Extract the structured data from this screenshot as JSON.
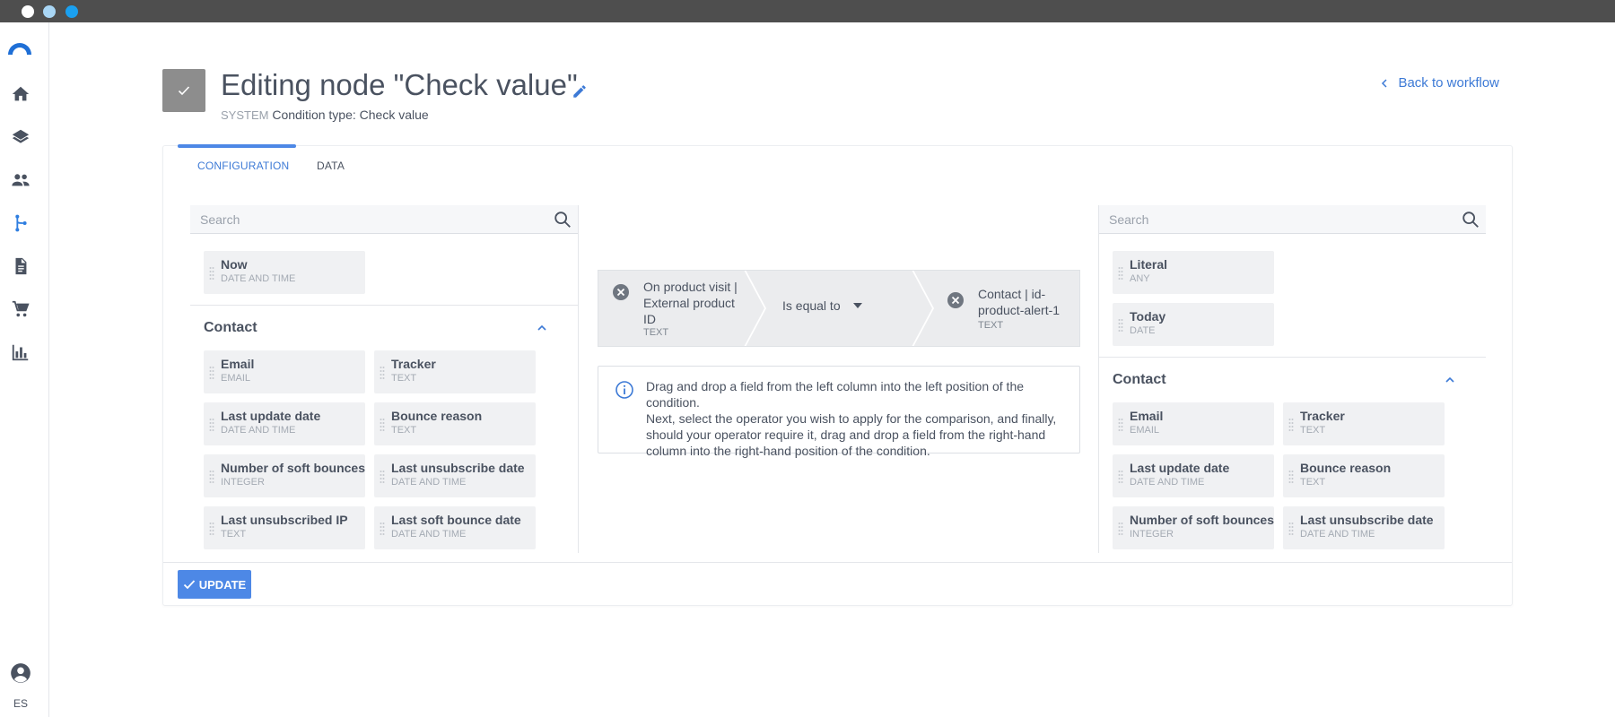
{
  "window": {
    "controls": [
      "close",
      "minimize",
      "maximize"
    ]
  },
  "sidebar": {
    "items": [
      {
        "name": "home-icon"
      },
      {
        "name": "layers-icon"
      },
      {
        "name": "people-icon"
      },
      {
        "name": "workflow-icon",
        "active": true
      },
      {
        "name": "document-icon"
      },
      {
        "name": "cart-icon"
      },
      {
        "name": "chart-icon"
      }
    ],
    "language": "ES"
  },
  "header": {
    "title": "Editing node \"Check value\"",
    "system_label": "SYSTEM",
    "condition_type": "Condition type: Check value",
    "back_label": "Back to workflow"
  },
  "tabs": [
    {
      "label": "CONFIGURATION",
      "active": true
    },
    {
      "label": "DATA",
      "active": false
    }
  ],
  "left_panel": {
    "search_placeholder": "Search",
    "top_fields": [
      {
        "name": "Now",
        "type": "DATE AND TIME"
      }
    ],
    "group_title": "Contact",
    "fields": [
      {
        "name": "Email",
        "type": "EMAIL"
      },
      {
        "name": "Tracker",
        "type": "TEXT"
      },
      {
        "name": "Last update date",
        "type": "DATE AND TIME"
      },
      {
        "name": "Bounce reason",
        "type": "TEXT"
      },
      {
        "name": "Number of soft bounces",
        "type": "INTEGER"
      },
      {
        "name": "Last unsubscribe date",
        "type": "DATE AND TIME"
      },
      {
        "name": "Last unsubscribed IP",
        "type": "TEXT"
      },
      {
        "name": "Last soft bounce date",
        "type": "DATE AND TIME"
      }
    ]
  },
  "right_panel": {
    "search_placeholder": "Search",
    "top_fields": [
      {
        "name": "Literal",
        "type": "ANY"
      },
      {
        "name": "Today",
        "type": "DATE"
      }
    ],
    "group_title": "Contact",
    "fields": [
      {
        "name": "Email",
        "type": "EMAIL"
      },
      {
        "name": "Tracker",
        "type": "TEXT"
      },
      {
        "name": "Last update date",
        "type": "DATE AND TIME"
      },
      {
        "name": "Bounce reason",
        "type": "TEXT"
      },
      {
        "name": "Number of soft bounces",
        "type": "INTEGER"
      },
      {
        "name": "Last unsubscribe date",
        "type": "DATE AND TIME"
      }
    ]
  },
  "condition": {
    "left_operand": {
      "lines": [
        "On product visit |",
        "External product",
        "ID"
      ],
      "type": "TEXT"
    },
    "operator": "Is equal to",
    "right_operand": {
      "lines": [
        "Contact | id-",
        "product-alert-1"
      ],
      "type": "TEXT"
    }
  },
  "info": {
    "lines": [
      "Drag and drop a field from the left column into the left position of the condition.",
      "Next, select the operator you wish to apply for the comparison, and finally,",
      "should your operator require it, drag and drop a field from the right-hand",
      "column into the right-hand position of the condition."
    ]
  },
  "update_label": "UPDATE",
  "colors": {
    "accent": "#4d88e6",
    "link": "#3d7ad6",
    "node_badge": "#8d8d8d",
    "chip_bg": "#f0f1f3",
    "condition_bg": "#ebecee",
    "logo": "#1f6fd6"
  }
}
